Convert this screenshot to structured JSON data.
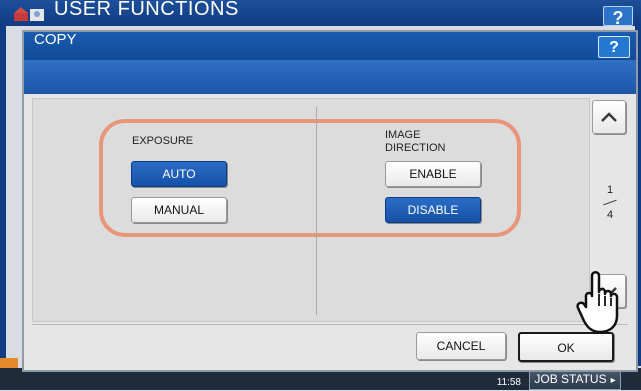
{
  "background": {
    "header_title": "USER FUNCTIONS",
    "help_label": "?",
    "clock": "11:58",
    "job_status_label": "JOB STATUS",
    "job_status_arrow": "▸"
  },
  "dialog": {
    "title": "COPY",
    "help_label": "?",
    "exposure": {
      "label": "EXPOSURE",
      "options": [
        {
          "label": "AUTO",
          "selected": true
        },
        {
          "label": "MANUAL",
          "selected": false
        }
      ]
    },
    "image_direction": {
      "label_line1": "IMAGE",
      "label_line2": "DIRECTION",
      "options": [
        {
          "label": "ENABLE",
          "selected": false
        },
        {
          "label": "DISABLE",
          "selected": true
        }
      ]
    },
    "pagination": {
      "current": "1",
      "total": "4"
    },
    "cancel_label": "CANCEL",
    "ok_label": "OK"
  },
  "colors": {
    "title_blue": "#1a5cb0",
    "selected_blue": "#1552a8",
    "highlight_ring": "#e8967a"
  }
}
